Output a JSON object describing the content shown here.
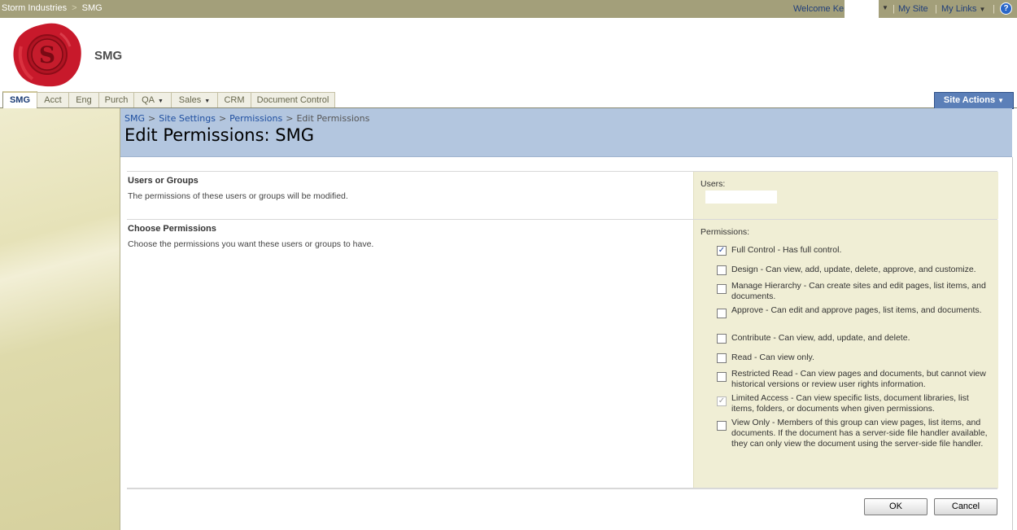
{
  "topbar": {
    "crumbs": [
      "Storm Industries",
      "SMG"
    ],
    "crumb_sep": ">",
    "welcome": "Welcome Ken",
    "my_site": "My Site",
    "my_links": "My Links",
    "divider": "|",
    "help_icon": "?",
    "dropdown_icon": "▼"
  },
  "header": {
    "site_title": "SMG"
  },
  "nav": {
    "tabs": [
      {
        "label": "SMG"
      },
      {
        "label": "Acct"
      },
      {
        "label": "Eng"
      },
      {
        "label": "Purch"
      },
      {
        "label": "QA"
      },
      {
        "label": "Sales"
      },
      {
        "label": "CRM"
      },
      {
        "label": "Document Control"
      }
    ],
    "dropdown_icon": "▼",
    "site_actions": "Site Actions",
    "site_actions_icon": "▼"
  },
  "title_area": {
    "breadcrumb": [
      "SMG",
      "Site Settings",
      "Permissions",
      "Edit Permissions"
    ],
    "breadcrumb_sep": ">",
    "page_title": "Edit Permissions: SMG"
  },
  "form": {
    "users_section": {
      "title": "Users or Groups",
      "description": "The permissions of these users or groups will be modified.",
      "field_label": "Users:"
    },
    "permissions_section": {
      "title": "Choose Permissions",
      "description": "Choose the permissions you want these users or groups to have.",
      "field_label": "Permissions:"
    },
    "permissions": [
      {
        "label": "Full Control - Has full control.",
        "checked": true,
        "disabled": false,
        "mark": "✓"
      },
      {
        "label": "Design - Can view, add, update, delete, approve, and customize.",
        "checked": false,
        "disabled": false,
        "mark": ""
      },
      {
        "label": "Manage Hierarchy - Can create sites and edit pages, list items, and documents.",
        "checked": false,
        "disabled": false,
        "mark": ""
      },
      {
        "label": "Approve - Can edit and approve pages, list items, and documents.",
        "checked": false,
        "disabled": false,
        "mark": ""
      },
      {
        "label": "Contribute - Can view, add, update, and delete.",
        "checked": false,
        "disabled": false,
        "mark": ""
      },
      {
        "label": "Read - Can view only.",
        "checked": false,
        "disabled": false,
        "mark": ""
      },
      {
        "label": "Restricted Read - Can view pages and documents, but cannot view historical versions or review user rights information.",
        "checked": false,
        "disabled": false,
        "mark": ""
      },
      {
        "label": "Limited Access - Can view specific lists, document libraries, list items, folders, or documents when given permissions.",
        "checked": true,
        "disabled": true,
        "mark": "✓"
      },
      {
        "label": "View Only - Members of this group can view pages, list items, and documents. If the document has a server-side file handler available, they can only view the document using the server-side file handler.",
        "checked": false,
        "disabled": false,
        "mark": ""
      }
    ],
    "ok_label": "OK",
    "cancel_label": "Cancel"
  },
  "colors": {
    "topbar": "#a39f7a",
    "title_band": "#b3c6df",
    "field_panel": "#f0eed5",
    "site_actions": "#5b7fb8",
    "logo_seal": "#c8192b"
  }
}
